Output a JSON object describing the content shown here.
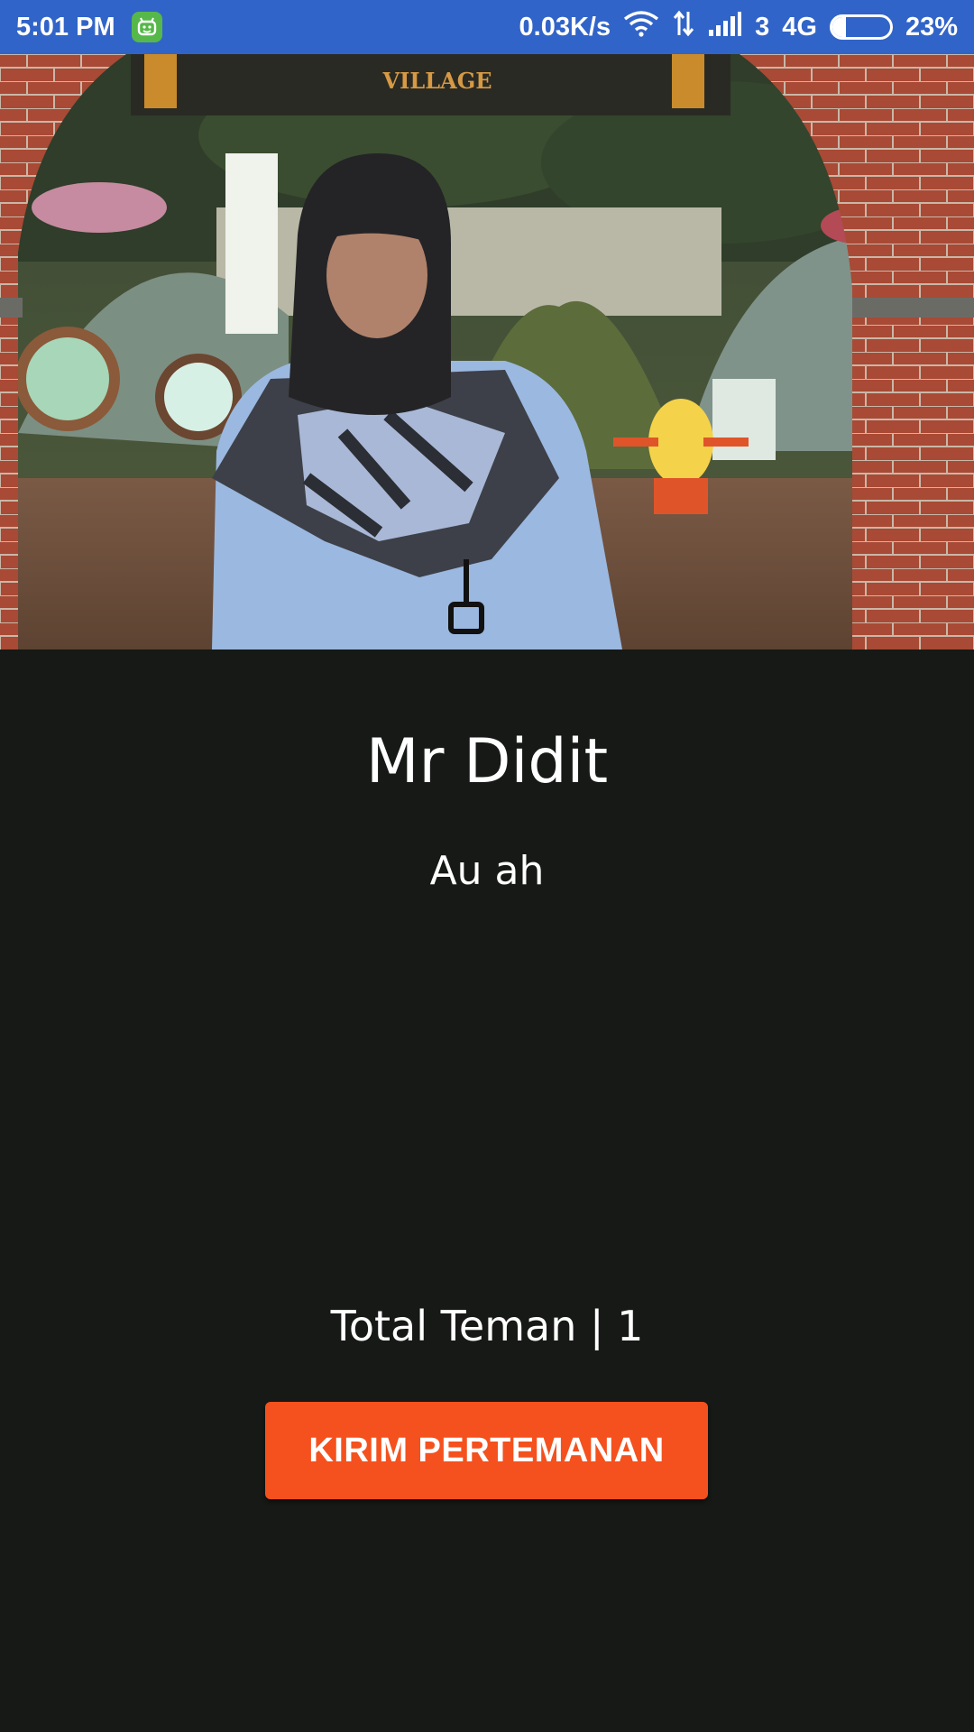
{
  "status_bar": {
    "time": "5:01 PM",
    "net_speed": "0.03K/s",
    "sim_slot": "3",
    "network_type": "4G",
    "battery_percent": "23%",
    "battery_level": 0.23,
    "icons": [
      "app-notification-icon",
      "wifi-icon",
      "data-activity-icon",
      "signal-icon",
      "battery-icon"
    ]
  },
  "profile": {
    "photo_sign_text": "VILLAGE",
    "name": "Mr Didit",
    "status": "Au ah",
    "friends_count_text": "Total Teman | 1",
    "add_friend_label": "KIRIM PERTEMANAN"
  },
  "colors": {
    "status_bar_bg": "#3164c8",
    "page_bg": "#161915",
    "button_bg": "#f4511e",
    "text": "#ffffff"
  }
}
